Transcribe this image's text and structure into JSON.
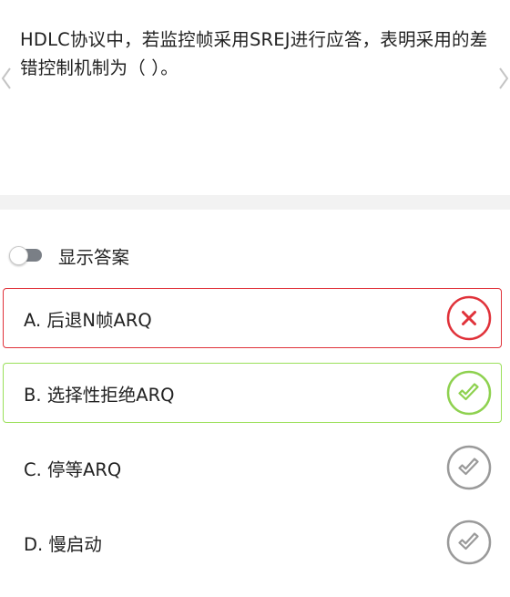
{
  "question": {
    "text": "HDLC协议中，若监控帧采用SREJ进行应答，表明采用的差错控制机制为（ ）。"
  },
  "answer_toggle": {
    "label": "显示答案",
    "state": "off"
  },
  "options": [
    {
      "label": "A. 后退N帧ARQ",
      "status": "wrong",
      "icon": "x-circle-icon"
    },
    {
      "label": "B. 选择性拒绝ARQ",
      "status": "correct",
      "icon": "check-circle-icon"
    },
    {
      "label": "C. 停等ARQ",
      "status": "neutral",
      "icon": "check-circle-icon"
    },
    {
      "label": "D. 慢启动",
      "status": "neutral",
      "icon": "check-circle-icon"
    }
  ],
  "colors": {
    "wrong": "#e0323a",
    "correct": "#8ed14f",
    "neutral": "#9a9a9a",
    "text": "#222222",
    "divider": "#f2f2f2"
  }
}
